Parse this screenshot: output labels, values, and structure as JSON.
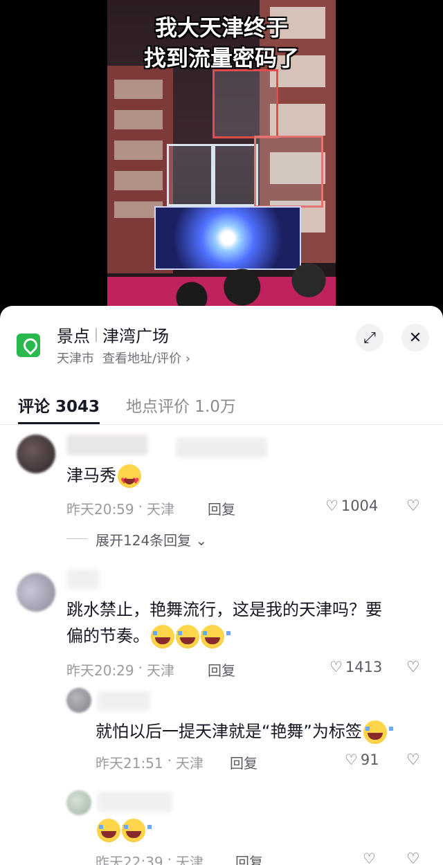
{
  "video": {
    "caption": "我大天津终于\n找到流量密码了"
  },
  "location": {
    "category": "景点",
    "name": "津湾广场",
    "city": "天津市",
    "link_label": "查看地址/评价",
    "link_chevron": "›",
    "pin_icon": "map-pin-icon",
    "expand_icon": "⤢",
    "close_icon": "✕"
  },
  "tabs": [
    {
      "label": "评论 3043"
    },
    {
      "label": "地点评价 1.0万"
    }
  ],
  "comments": [
    {
      "text": "津马秀",
      "emoji": "heart-eyes",
      "time": "昨天20:59",
      "dot": "·",
      "region": "天津",
      "reply_label": "回复",
      "likes": "1004",
      "expand_label": "展开124条回复",
      "expand_chevron": "⌄"
    },
    {
      "text_line1": "跳水禁止，艳舞流行，这是我的天津吗？要",
      "text_line2": "偏的节奏。",
      "emoji": "tears-of-joy",
      "time": "昨天20:29",
      "dot": "·",
      "region": "天津",
      "reply_label": "回复",
      "likes": "1413",
      "replies": [
        {
          "text": "就怕以后一提天津就是“艳舞”为标签",
          "emoji": "tears-of-joy",
          "time": "昨天21:51",
          "dot": "·",
          "region": "天津",
          "reply_label": "回复",
          "likes": "91"
        },
        {
          "emoji": "tears-of-joy",
          "time": "昨天22:39",
          "dot": "·",
          "region": "天津",
          "reply_label": "回复"
        }
      ]
    }
  ],
  "icons": {
    "like": "♡",
    "dislike": "♡"
  },
  "colors": {
    "pin": "#28b84e",
    "text_primary": "#161823",
    "text_secondary": "#9a9ba1"
  }
}
